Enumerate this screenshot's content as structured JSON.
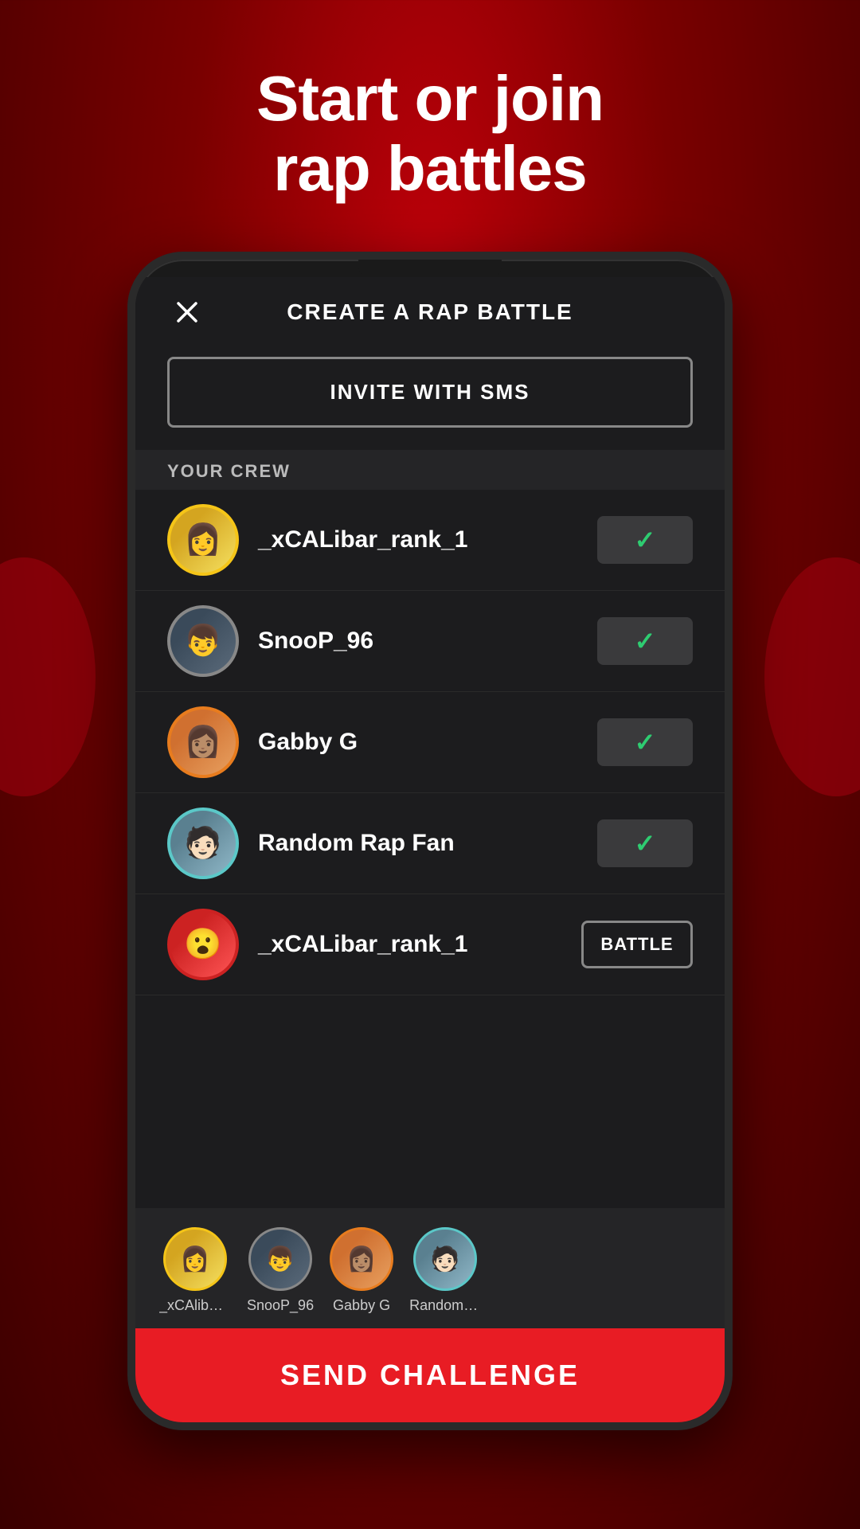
{
  "hero": {
    "title_line1": "Start or join",
    "title_line2": "rap battles"
  },
  "screen": {
    "header_title": "CREATE A RAP BATTLE",
    "invite_btn_label": "INVITE WITH SMS",
    "section_crew": "YOUR CREW",
    "crew_items": [
      {
        "id": "crew1",
        "name": "_xCALibar_rank_1",
        "avatar_color1": "#c89820",
        "avatar_color2": "#f5d050",
        "border_color": "#f5c518",
        "action": "check",
        "selected": true
      },
      {
        "id": "crew2",
        "name": "SnooP_96",
        "avatar_color1": "#2a3a4a",
        "avatar_color2": "#4a5a6a",
        "border_color": "#888",
        "action": "check",
        "selected": true
      },
      {
        "id": "crew3",
        "name": "Gabby G",
        "avatar_color1": "#c06818",
        "avatar_color2": "#e89848",
        "border_color": "#e87c1e",
        "action": "check",
        "selected": true
      },
      {
        "id": "crew4",
        "name": "Random Rap Fan",
        "avatar_color1": "#4a7888",
        "avatar_color2": "#7ab0c0",
        "border_color": "#5bc8c8",
        "action": "check",
        "selected": true
      },
      {
        "id": "crew5",
        "name": "_xCALibar_rank_1",
        "avatar_color1": "#aa1010",
        "avatar_color2": "#ee4040",
        "border_color": "#cc2222",
        "action": "battle",
        "selected": false
      }
    ],
    "selected_crew": [
      {
        "id": "sel1",
        "short_name": "_xCAlibar_r",
        "color1": "#c89820",
        "color2": "#f5d050",
        "border": "#f5c518"
      },
      {
        "id": "sel2",
        "short_name": "SnooP_96",
        "color1": "#2a3a4a",
        "color2": "#4a5a6a",
        "border": "#888"
      },
      {
        "id": "sel3",
        "short_name": "Gabby G",
        "color1": "#c06818",
        "color2": "#e89848",
        "border": "#e87c1e"
      },
      {
        "id": "sel4",
        "short_name": "Random Ra..",
        "color1": "#4a7888",
        "color2": "#7ab0c0",
        "border": "#5bc8c8"
      }
    ],
    "send_btn_label": "SEND CHALLENGE"
  }
}
